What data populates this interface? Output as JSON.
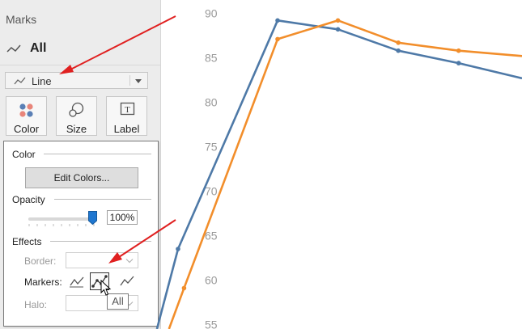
{
  "marks_panel": {
    "title": "Marks",
    "all_label": "All",
    "mark_type": "Line",
    "buttons": [
      {
        "label": "Color",
        "icon": "color-dots-icon"
      },
      {
        "label": "Size",
        "icon": "size-circles-icon"
      },
      {
        "label": "Label",
        "icon": "label-text-icon"
      }
    ]
  },
  "color_popup": {
    "color_heading": "Color",
    "edit_colors_label": "Edit Colors...",
    "opacity_heading": "Opacity",
    "opacity_value": "100%",
    "opacity_level": 1.0,
    "effects_heading": "Effects",
    "border_label": "Border:",
    "markers_label": "Markers:",
    "halo_label": "Halo:",
    "markers_options": [
      "markers-none-icon",
      "markers-all-icon",
      "markers-automatic-icon"
    ],
    "selected_marker_option": 1,
    "tooltip": "All"
  },
  "colors": {
    "series_blue": "#4e79a7",
    "series_orange": "#f28e2b",
    "slider_thumb": "#1f77d0",
    "annotation_arrow": "#e02020"
  },
  "chart_data": {
    "type": "line",
    "ylim": [
      54.5,
      91.5
    ],
    "yticks": [
      55,
      60,
      65,
      70,
      75,
      80,
      85,
      90
    ],
    "xlim": [
      -2.6,
      6.05
    ],
    "grid": false,
    "series": [
      {
        "values": [
          {
            "x": 0,
            "y": 54.5
          },
          {
            "x": 0.35,
            "y": 63.5
          },
          {
            "x": 2,
            "y": 89.2
          },
          {
            "x": 3,
            "y": 88.2
          },
          {
            "x": 4,
            "y": 85.8
          },
          {
            "x": 5,
            "y": 84.4
          },
          {
            "x": 6.05,
            "y": 82.7
          }
        ]
      },
      {
        "values": [
          {
            "x": 0.2,
            "y": 54.5
          },
          {
            "x": 0.45,
            "y": 59.1
          },
          {
            "x": 2,
            "y": 87.1
          },
          {
            "x": 3,
            "y": 89.2
          },
          {
            "x": 4,
            "y": 86.7
          },
          {
            "x": 5,
            "y": 85.8
          },
          {
            "x": 6.05,
            "y": 85.2
          }
        ]
      }
    ]
  }
}
